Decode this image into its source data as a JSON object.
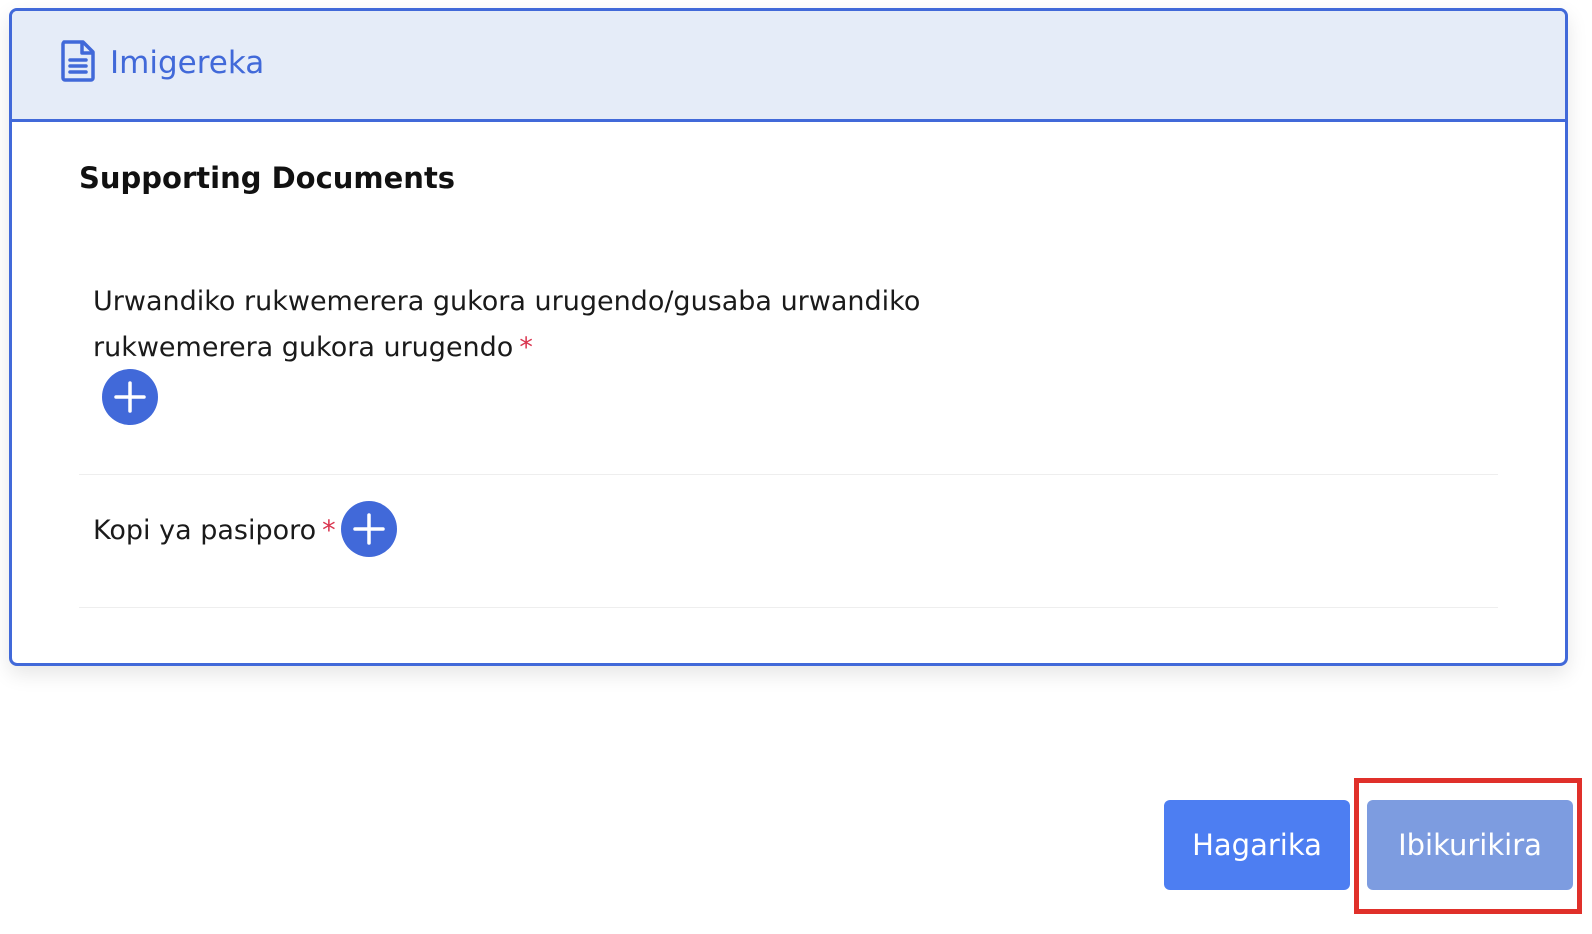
{
  "header": {
    "icon": "document-icon",
    "title": "Imigereka"
  },
  "section": {
    "title": "Supporting Documents"
  },
  "documents": [
    {
      "label": "Urwandiko rukwemerera gukora urugendo/gusaba urwandiko rukwemerera gukora urugendo",
      "required_mark": "*",
      "add_icon": "plus-icon"
    },
    {
      "label": "Kopi ya pasiporo",
      "required_mark": "*",
      "add_icon": "plus-icon"
    }
  ],
  "actions": {
    "cancel_label": "Hagarika",
    "next_label": "Ibikurikira"
  },
  "colors": {
    "accent": "#4169d9",
    "header_bg": "#e5ecf8",
    "required": "#d9344e",
    "cancel_button": "#4d7ef2",
    "next_button": "#7d9ce0",
    "highlight": "#e0302a"
  }
}
